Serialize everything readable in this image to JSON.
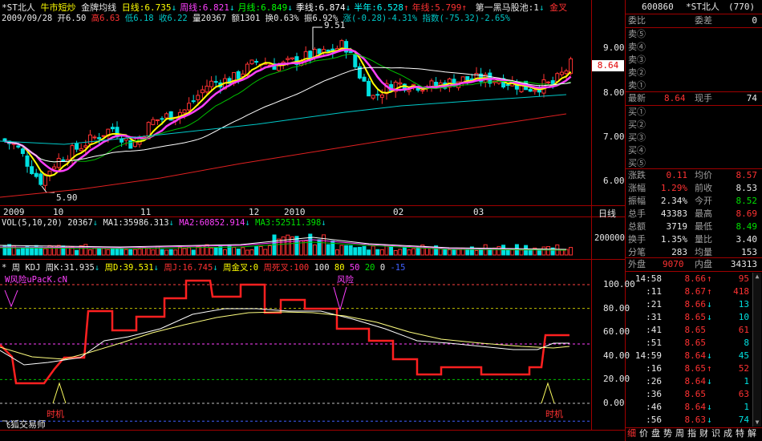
{
  "header": {
    "symbol": "*ST北人",
    "indicator_name": "牛市短炒",
    "indicator_sub": "金牌均线",
    "items": [
      {
        "label": "日线:6.735",
        "arrow": "↓",
        "color": "#ffff00"
      },
      {
        "label": "周线:6.821",
        "arrow": "↓",
        "color": "#ff40ff"
      },
      {
        "label": "月线:6.849",
        "arrow": "↓",
        "color": "#00ff00"
      },
      {
        "label": "季线:6.874",
        "arrow": "↓",
        "color": "#ffffff"
      },
      {
        "label": "半年:6.528",
        "arrow": "↑",
        "color": "#00ffff"
      },
      {
        "label": "年线:5.799",
        "arrow": "↑",
        "color": "#ff3232"
      }
    ],
    "pool_label": "第一黑马股池:1",
    "pool_arrow": "↓",
    "golden_cross": "金叉"
  },
  "ohlc_line": {
    "date": "2009/09/28",
    "open": "开6.50",
    "high": "高6.63",
    "low": "低6.18",
    "close": "收6.22",
    "volume": "量20367",
    "amount": "额1301",
    "turnover": "换0.63%",
    "amplitude": "振6.92%",
    "change": "涨(-0.28)-4.31%",
    "index_change": "指数(-75.32)-2.65%"
  },
  "price_chart": {
    "high_label": "9.51",
    "low_label": "5.90",
    "current_price_tag": "8.64",
    "y_ticks": [
      "9.00",
      "8.00",
      "7.00",
      "6.00"
    ],
    "x_ticks": [
      "2009",
      "10",
      "11",
      "12",
      "2010",
      "02",
      "03"
    ],
    "period_label": "日线"
  },
  "volume_chart": {
    "title": "VOL(5,10,20)",
    "value": "20367",
    "value_arrow": "↓",
    "ma1": "MA1:35986.313",
    "ma1_arrow": "↓",
    "ma2": "MA2:60852.914",
    "ma2_arrow": "↓",
    "ma3": "MA3:52511.398",
    "ma3_arrow": "↓",
    "y_tick": "200000"
  },
  "kdj_chart": {
    "title": "* 周 KDJ",
    "k": "周K:31.935",
    "k_arrow": "↓",
    "d": "周D:39.531",
    "d_arrow": "↓",
    "j": "周J:16.745",
    "j_arrow": "↓",
    "golden": "周金叉:0",
    "death": "周死叉:100",
    "lv100": "100",
    "lv80": "80",
    "lv50": "50",
    "lv20": "20",
    "lv0": "0",
    "lvm15": "-15",
    "watermark": "W风险uPacK.cN",
    "risk_label": "风险",
    "timing_label_left": "时机",
    "timing_label_right": "时机",
    "y_ticks": [
      "100.00",
      "80.00",
      "60.00",
      "40.00",
      "20.00",
      "0.00"
    ],
    "footer": "飞狐交易师"
  },
  "quote_panel": {
    "code": "600860",
    "name": "*ST北人",
    "count": "(770)",
    "webi_label": "委比",
    "wecha_label": "委差",
    "webi_value": "",
    "wecha_value": "0",
    "sells": [
      "卖⑤",
      "卖④",
      "卖③",
      "卖②",
      "卖①"
    ],
    "latest_label": "最新",
    "latest_value": "8.64",
    "hand_label": "现手",
    "hand_value": "74",
    "buys": [
      "买①",
      "买②",
      "买③",
      "买④",
      "买⑤"
    ],
    "stats": [
      {
        "l1": "涨跌",
        "v1": "0.11",
        "c1": "#ff3232",
        "l2": "均价",
        "v2": "8.57",
        "c2": "#ff3232"
      },
      {
        "l1": "涨幅",
        "v1": "1.29%",
        "c1": "#ff3232",
        "l2": "前收",
        "v2": "8.53",
        "c2": "#e8e8e8"
      },
      {
        "l1": "振幅",
        "v1": "2.34%",
        "c1": "#e8e8e8",
        "l2": "今开",
        "v2": "8.52",
        "c2": "#00e000"
      },
      {
        "l1": "总手",
        "v1": "43383",
        "c1": "#e8e8e8",
        "l2": "最高",
        "v2": "8.69",
        "c2": "#ff3232"
      },
      {
        "l1": "总额",
        "v1": "3719",
        "c1": "#e8e8e8",
        "l2": "最低",
        "v2": "8.49",
        "c2": "#00e000"
      },
      {
        "l1": "换手",
        "v1": "1.35%",
        "c1": "#e8e8e8",
        "l2": "量比",
        "v2": "3.40",
        "c2": "#e8e8e8"
      },
      {
        "l1": "分笔",
        "v1": "283",
        "c1": "#e8e8e8",
        "l2": "均量",
        "v2": "153",
        "c2": "#e8e8e8"
      }
    ],
    "outer_label": "外盘",
    "outer_value": "9070",
    "inner_label": "内盘",
    "inner_value": "34313",
    "ticks": [
      {
        "time": "14:58",
        "price": "8.66",
        "arrow": "↑",
        "vol": "95",
        "pc": "#ff3232",
        "vc": "#ff3232"
      },
      {
        "time": ":11",
        "price": "8.67",
        "arrow": "↑",
        "vol": "418",
        "pc": "#ff3232",
        "vc": "#ff3232"
      },
      {
        "time": ":21",
        "price": "8.66",
        "arrow": "↓",
        "vol": "13",
        "pc": "#ff3232",
        "vc": "#00e0e0"
      },
      {
        "time": ":31",
        "price": "8.65",
        "arrow": "↓",
        "vol": "10",
        "pc": "#ff3232",
        "vc": "#00e0e0"
      },
      {
        "time": ":41",
        "price": "8.65",
        "arrow": "",
        "vol": "61",
        "pc": "#ff3232",
        "vc": "#ff3232"
      },
      {
        "time": ":51",
        "price": "8.65",
        "arrow": "",
        "vol": "8",
        "pc": "#ff3232",
        "vc": "#00e0e0"
      },
      {
        "time": "14:59",
        "price": "8.64",
        "arrow": "↓",
        "vol": "45",
        "pc": "#ff3232",
        "vc": "#00e0e0"
      },
      {
        "time": ":16",
        "price": "8.65",
        "arrow": "↑",
        "vol": "52",
        "pc": "#ff3232",
        "vc": "#ff3232"
      },
      {
        "time": ":26",
        "price": "8.64",
        "arrow": "↓",
        "vol": "1",
        "pc": "#ff3232",
        "vc": "#00e0e0"
      },
      {
        "time": ":36",
        "price": "8.65",
        "arrow": "",
        "vol": "63",
        "pc": "#ff3232",
        "vc": "#ff3232"
      },
      {
        "time": ":46",
        "price": "8.64",
        "arrow": "↓",
        "vol": "1",
        "pc": "#ff3232",
        "vc": "#00e0e0"
      },
      {
        "time": ":56",
        "price": "8.63",
        "arrow": "↓",
        "vol": "74",
        "pc": "#ff3232",
        "vc": "#00e0e0"
      }
    ],
    "bottom_tabs": [
      "细",
      "价",
      "盘",
      "势",
      "周",
      "指",
      "财",
      "识",
      "成",
      "特",
      "解"
    ]
  },
  "colors": {
    "up": "#ff3232",
    "down": "#00e0e0",
    "border": "#a00000",
    "ma_yellow": "#ffff00",
    "ma_magenta": "#ff40ff",
    "ma_green": "#00c000",
    "ma_white": "#ffffff",
    "ma_cyan": "#00c8c8",
    "ma_red": "#e02020"
  }
}
